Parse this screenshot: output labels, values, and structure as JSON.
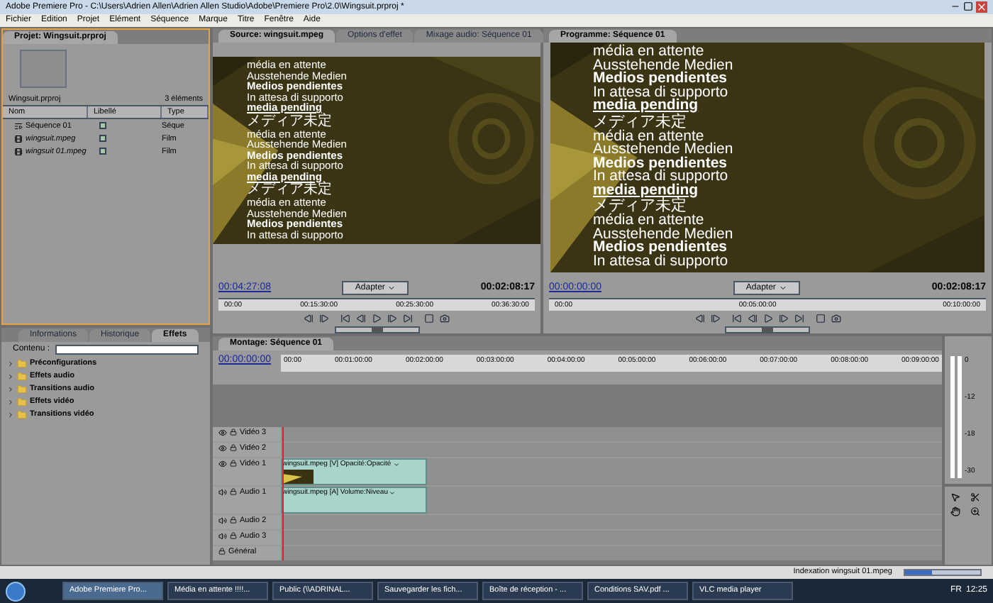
{
  "window": {
    "title": "Adobe Premiere Pro - C:\\Users\\Adrien Allen\\Adrien Allen Studio\\Adobe\\Premiere Pro\\2.0\\Wingsuit.prproj *"
  },
  "menu": [
    "Fichier",
    "Edition",
    "Projet",
    "Elément",
    "Séquence",
    "Marque",
    "Titre",
    "Fenêtre",
    "Aide"
  ],
  "project": {
    "tab": "Projet: Wingsuit.prproj",
    "file_name": "Wingsuit.prproj",
    "item_count": "3 éléments",
    "columns": [
      "Nom",
      "Libellé",
      "Type"
    ],
    "items": [
      {
        "kind": "sequence",
        "name": "Séquence 01",
        "type": "Séque"
      },
      {
        "kind": "film",
        "name": "wingsuit.mpeg",
        "type": "Film"
      },
      {
        "kind": "film",
        "name": "wingsuit 01.mpeg",
        "type": "Film"
      }
    ]
  },
  "effects_panel": {
    "tabs": [
      {
        "label": "Informations",
        "selected": false
      },
      {
        "label": "Historique",
        "selected": false
      },
      {
        "label": "Effets",
        "selected": true
      }
    ],
    "search_label": "Contenu :",
    "folders": [
      "Préconfigurations",
      "Effets audio",
      "Transitions audio",
      "Effets vidéo",
      "Transitions vidéo"
    ]
  },
  "source_monitor": {
    "tabs": [
      {
        "label": "Source: wingsuit.mpeg",
        "selected": true
      },
      {
        "label": "Options d'effet",
        "selected": false
      },
      {
        "label": "Mixage audio: Séquence 01",
        "selected": false
      }
    ],
    "overlay_lines": [
      {
        "kind": "plain",
        "text": "média en attente"
      },
      {
        "kind": "plain",
        "text": "Ausstehende Medien"
      },
      {
        "kind": "bold",
        "text": "Medios pendientes"
      },
      {
        "kind": "plain",
        "text": "In attesa di supporto"
      },
      {
        "kind": "heavy",
        "text": "media pending"
      },
      {
        "kind": "plain",
        "text": "メディア未定"
      },
      {
        "kind": "plain",
        "text": "média en attente"
      },
      {
        "kind": "plain",
        "text": "Ausstehende Medien"
      },
      {
        "kind": "bold",
        "text": "Medios pendientes"
      },
      {
        "kind": "plain",
        "text": "In attesa di supporto"
      },
      {
        "kind": "heavy",
        "text": "media pending"
      },
      {
        "kind": "plain",
        "text": "メディア未定"
      },
      {
        "kind": "plain",
        "text": "média en attente"
      },
      {
        "kind": "plain",
        "text": "Ausstehende Medien"
      },
      {
        "kind": "bold",
        "text": "Medios pendientes"
      },
      {
        "kind": "plain",
        "text": "In attesa di supporto"
      }
    ],
    "timecode": "00:04:27:08",
    "zoom": "Adapter",
    "duration": "00:02:08:17",
    "ruler": [
      "00:00",
      "00:15:30:00",
      "00:25:30:00",
      "00:36:30:00"
    ],
    "shuttle": {
      "level": 0.5
    }
  },
  "program_monitor": {
    "tabs": [
      {
        "label": "Programme: Séquence 01",
        "selected": true
      }
    ],
    "overlay_lines": [
      {
        "kind": "plain",
        "text": "média en attente"
      },
      {
        "kind": "plain",
        "text": "Ausstehende Medien"
      },
      {
        "kind": "bold",
        "text": "Medios pendientes"
      },
      {
        "kind": "plain",
        "text": "In attesa di supporto"
      },
      {
        "kind": "heavy",
        "text": "media pending"
      },
      {
        "kind": "plain",
        "text": "メディア未定"
      },
      {
        "kind": "plain",
        "text": "média en attente"
      },
      {
        "kind": "plain",
        "text": "Ausstehende Medien"
      },
      {
        "kind": "bold",
        "text": "Medios pendientes"
      },
      {
        "kind": "plain",
        "text": "In attesa di supporto"
      },
      {
        "kind": "heavy",
        "text": "media pending"
      },
      {
        "kind": "plain",
        "text": "メディア未定"
      },
      {
        "kind": "plain",
        "text": "média en attente"
      },
      {
        "kind": "plain",
        "text": "Ausstehende Medien"
      },
      {
        "kind": "bold",
        "text": "Medios pendientes"
      },
      {
        "kind": "plain",
        "text": "In attesa di supporto"
      }
    ],
    "timecode": "00:00:00:00",
    "zoom": "Adapter",
    "duration": "00:02:08:17",
    "ruler": [
      "00:00",
      "00:05:00:00",
      "00:10:00:00"
    ],
    "shuttle": {
      "level": 0.5
    }
  },
  "timeline": {
    "tab": "Montage: Séquence 01",
    "timecode": "00:00:00:00",
    "ruler": [
      "00:00",
      "00:01:00:00",
      "00:02:00:00",
      "00:03:00:00",
      "00:04:00:00",
      "00:05:00:00",
      "00:06:00:00",
      "00:07:00:00",
      "00:08:00:00",
      "00:09:00:00"
    ],
    "tracks": [
      {
        "kind": "video",
        "name": "Vidéo 3"
      },
      {
        "kind": "video",
        "name": "Vidéo 2"
      },
      {
        "kind": "video",
        "name": "Vidéo 1",
        "clip": "wingsuit.mpeg [V] Opacité:Opacité"
      },
      {
        "kind": "audio",
        "name": "Audio 1",
        "clip": "wingsuit.mpeg [A] Volume:Niveau"
      },
      {
        "kind": "audio",
        "name": "Audio 2"
      },
      {
        "kind": "audio",
        "name": "Audio 3"
      },
      {
        "kind": "master",
        "name": "Général"
      }
    ]
  },
  "audio_meter": {
    "scale": [
      "0",
      "-12",
      "-18",
      "-30"
    ]
  },
  "status_bar": {
    "task": "Indexation wingsuit 01.mpeg",
    "level": 0.35
  },
  "taskbar": {
    "items": [
      {
        "label": "Adobe Premiere Pro...",
        "selected": true
      },
      {
        "label": "Média en attente !!!!...",
        "selected": false
      },
      {
        "label": "Public (\\\\ADRINAL...",
        "selected": false
      },
      {
        "label": "Sauvegarder les fich...",
        "selected": false
      },
      {
        "label": "Boîte de réception - ...",
        "selected": false
      },
      {
        "label": "Conditions SAV.pdf ...",
        "selected": false
      },
      {
        "label": "VLC media player",
        "selected": false
      }
    ],
    "language": "FR",
    "clock": "12:25"
  }
}
